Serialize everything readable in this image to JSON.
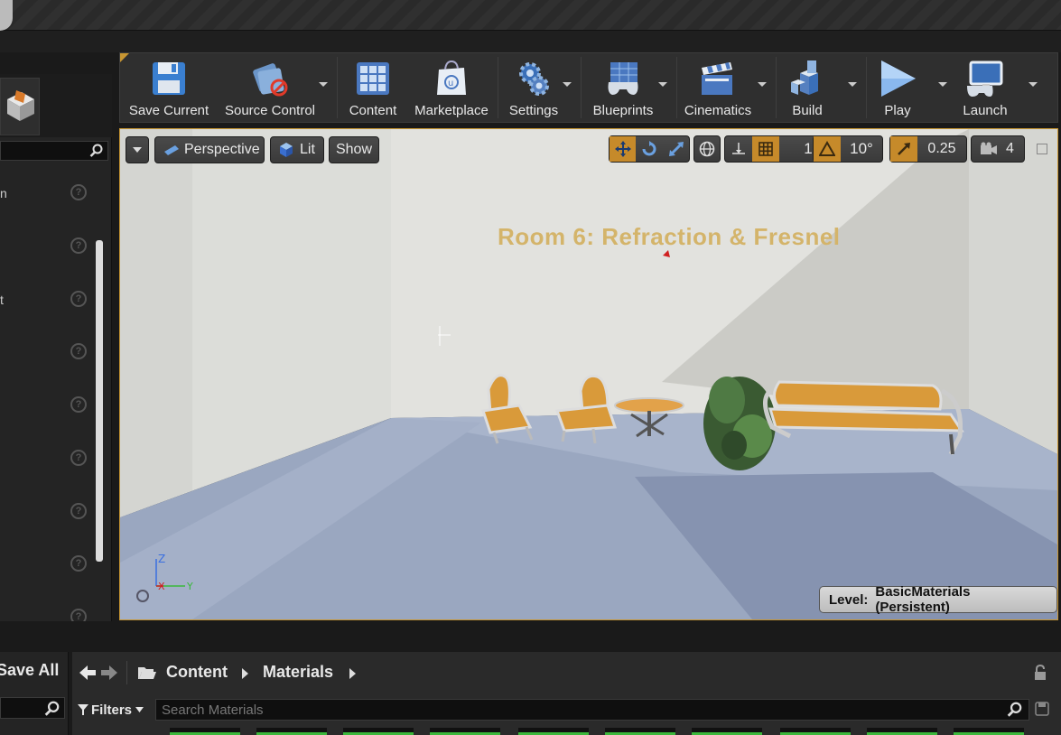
{
  "toolbar": {
    "buttons": [
      {
        "label": "Save Current",
        "icon": "floppy-disk-icon"
      },
      {
        "label": "Source Control",
        "icon": "source-control-icon"
      },
      {
        "label": "Content",
        "icon": "content-grid-icon"
      },
      {
        "label": "Marketplace",
        "icon": "marketplace-bag-icon"
      },
      {
        "label": "Settings",
        "icon": "gears-icon"
      },
      {
        "label": "Blueprints",
        "icon": "gamepad-icon"
      },
      {
        "label": "Cinematics",
        "icon": "clapperboard-icon"
      },
      {
        "label": "Build",
        "icon": "build-blocks-icon"
      },
      {
        "label": "Play",
        "icon": "play-icon"
      },
      {
        "label": "Launch",
        "icon": "monitor-gamepad-icon"
      }
    ]
  },
  "viewport": {
    "view_mode": "Perspective",
    "lighting_mode": "Lit",
    "show_label": "Show",
    "grid_snap_value": "1",
    "rotation_snap_value": "10°",
    "scale_snap_value": "0.25",
    "camera_speed_value": "4",
    "scene_title": "Room 6: Refraction & Fresnel",
    "level_label": "Level:",
    "level_name": "BasicMaterials (Persistent)",
    "axis_z": "Z",
    "axis_x": "X",
    "axis_y": "Y"
  },
  "left_panel": {
    "items": [
      "n",
      "",
      "t",
      "",
      "",
      "",
      "",
      "",
      ""
    ]
  },
  "content_browser": {
    "save_all": "Save All",
    "breadcrumbs": [
      "Content",
      "Materials"
    ],
    "filters_label": "Filters",
    "search_placeholder": "Search Materials"
  },
  "colors": {
    "accent_orange": "#c68a2a",
    "selection_border": "#c89632",
    "thumbnail_green": "#3cb83c"
  }
}
